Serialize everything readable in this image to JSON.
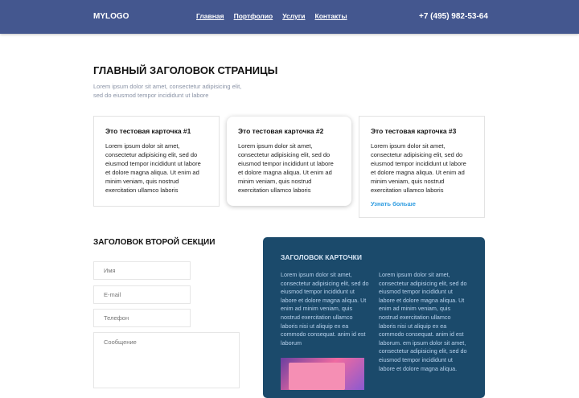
{
  "header": {
    "logo": "MYLOGO",
    "nav": [
      "Главная",
      "Портфолио",
      "Услуги",
      "Контакты"
    ],
    "phone": "+7 (495) 982-53-64"
  },
  "hero": {
    "title": "ГЛАВНЫЙ ЗАГОЛОВОК СТРАНИЦЫ",
    "subtitle": "Lorem ipsum dolor sit amet, consectetur adipisicing elit, sed do eiusmod tempor incididunt ut labore"
  },
  "cards": [
    {
      "title": "Это тестовая карточка #1",
      "text": "Lorem ipsum dolor sit amet, consectetur adipisicing elit, sed do eiusmod tempor incididunt ut labore et dolore magna aliqua. Ut enim ad minim veniam, quis nostrud exercitation ullamco laboris"
    },
    {
      "title": "Это тестовая карточка #2",
      "text": "Lorem ipsum dolor sit amet, consectetur adipisicing elit, sed do eiusmod tempor incididunt ut labore et dolore magna aliqua. Ut enim ad minim veniam, quis nostrud exercitation ullamco laboris"
    },
    {
      "title": "Это тестовая карточка #3",
      "text": "Lorem ipsum dolor sit amet, consectetur adipisicing elit, sed do eiusmod tempor incididunt ut labore et dolore magna aliqua. Ut enim ad minim veniam, quis nostrud exercitation ullamco laboris",
      "link": "Узнать больше"
    }
  ],
  "section2": {
    "title": "ЗАГОЛОВОК ВТОРОЙ СЕКЦИИ",
    "form": {
      "name": "Имя",
      "email": "E-mail",
      "phone": "Телефон",
      "message": "Сообщение"
    }
  },
  "dark_card": {
    "title": "ЗАГОЛОВОК КАРТОЧКИ",
    "col1": "Lorem ipsum dolor sit amet, consectetur adipisicing elit, sed do eiusmod tempor incididunt ut labore et dolore magna aliqua. Ut enim ad minim veniam, quis nostrud exercitation ullamco laboris nisi ut aliquip ex ea commodo consequat. anim id est laborum",
    "col2": "Lorem ipsum dolor sit amet, consectetur adipisicing elit, sed do eiusmod tempor incididunt ut labore et dolore magna aliqua. Ut enim ad minim veniam, quis nostrud exercitation ullamco laboris nisi ut aliquip ex ea commodo consequat. anim id est laborum. em ipsum dolor sit amet, consectetur adipisicing elit, sed do eiusmod tempor incididunt ut labore et dolore magna aliqua."
  },
  "colors": {
    "header": "#44578f",
    "dark_card": "#1b4a6b",
    "link": "#2a9ae0"
  }
}
